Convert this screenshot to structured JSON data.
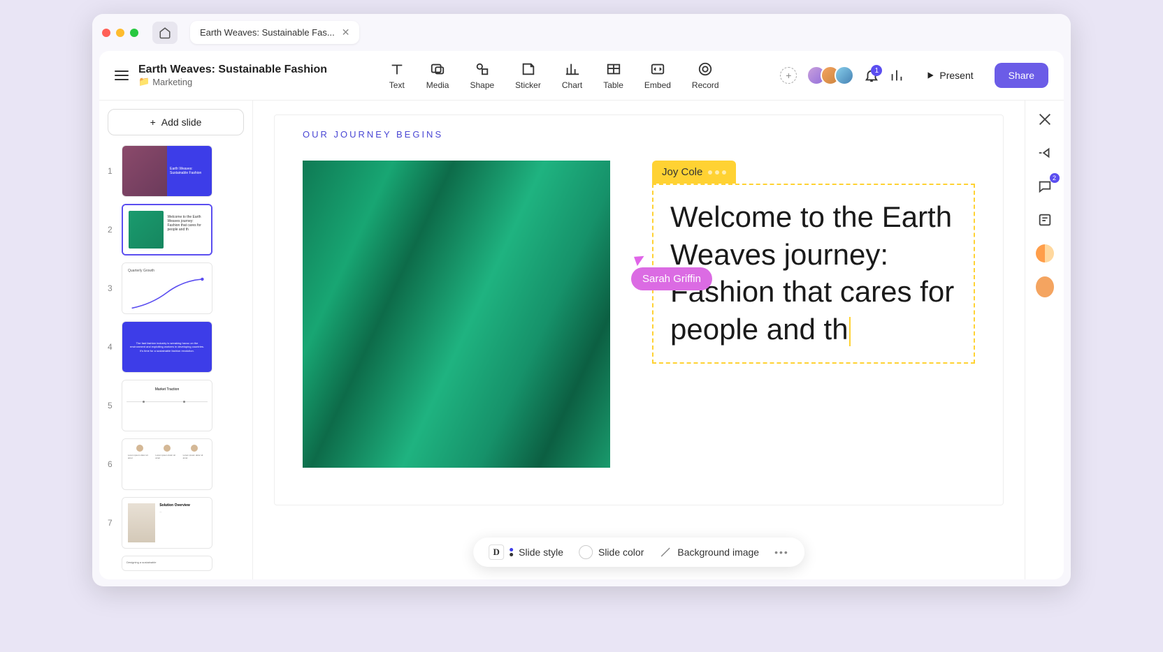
{
  "tab": {
    "title": "Earth Weaves: Sustainable Fas..."
  },
  "document": {
    "title": "Earth Weaves: Sustainable Fashion",
    "folder": "Marketing"
  },
  "tools": {
    "text": "Text",
    "media": "Media",
    "shape": "Shape",
    "sticker": "Sticker",
    "chart": "Chart",
    "table": "Table",
    "embed": "Embed",
    "record": "Record"
  },
  "header": {
    "notification_count": "1",
    "present": "Present",
    "share": "Share"
  },
  "sidebar": {
    "add_slide": "Add slide"
  },
  "thumbnails": {
    "t1_line1": "Earth Weaves:",
    "t1_line2": "Sustainable Fashion",
    "t2_text": "Welcome to the Earth Weaves journey: Fashion that cares for people and th",
    "t3_title": "Quarterly Growth",
    "t4_text": "The fast fashion industry is wreaking havoc on the environment and exploiting workers in developing countries. It's time for a sustainable fashion revolution.",
    "t5_title": "Market Traction",
    "t7_title": "Solution Overview",
    "t8_title": "Designing a sustainable"
  },
  "canvas": {
    "eyebrow": "OUR JOURNEY BEGINS",
    "collaborator_cursor": "Sarah Griffin",
    "editor_name": "Joy Cole",
    "main_text": "Welcome to the Earth Weaves journey: Fashion that cares for people and th"
  },
  "bottom_bar": {
    "slide_style": "Slide style",
    "slide_color": "Slide color",
    "bg_image": "Background image"
  },
  "right_rail": {
    "comment_count": "2"
  }
}
